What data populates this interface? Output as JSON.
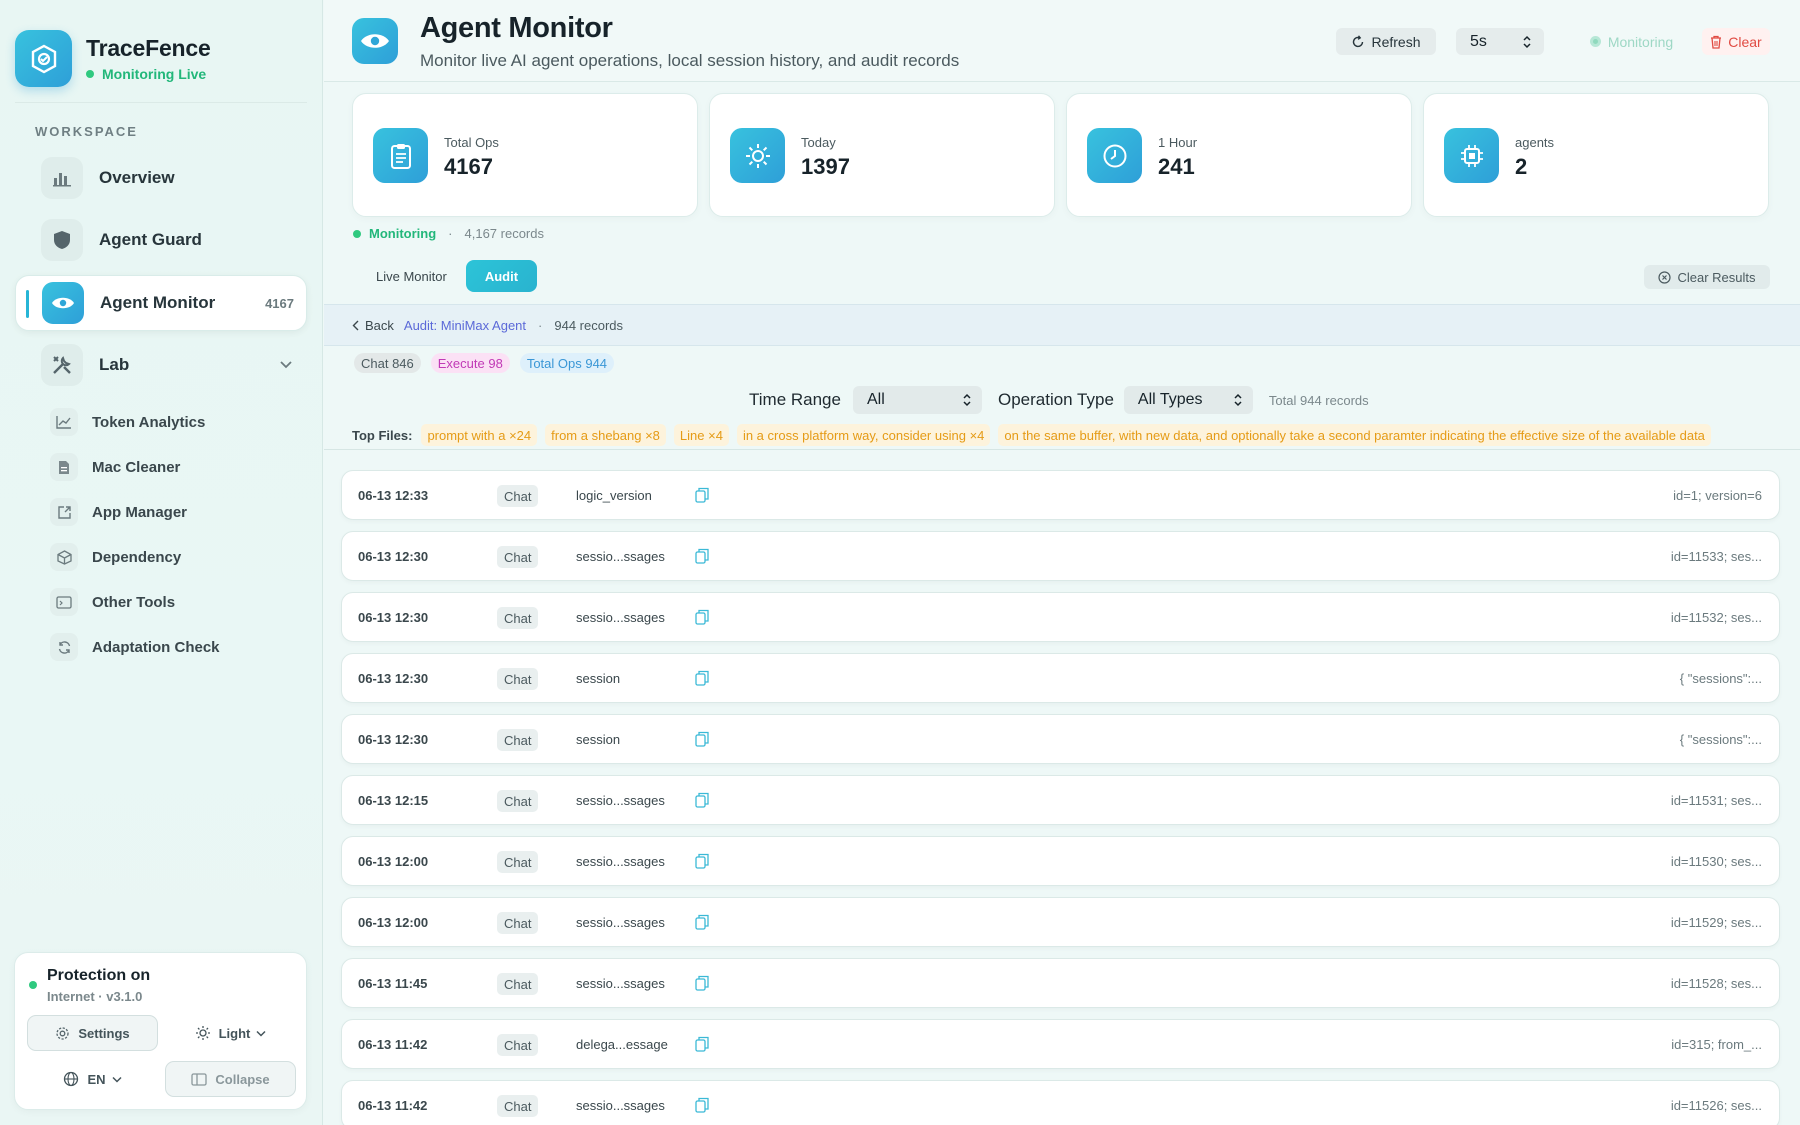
{
  "brand": {
    "name": "TraceFence",
    "status": "Monitoring Live"
  },
  "sidebar": {
    "section_label": "WORKSPACE",
    "items": [
      {
        "label": "Overview",
        "icon": "bar-chart-icon"
      },
      {
        "label": "Agent Guard",
        "icon": "shield-icon"
      },
      {
        "label": "Agent Monitor",
        "icon": "eye-icon",
        "badge": "4167"
      },
      {
        "label": "Lab",
        "icon": "tools-icon"
      }
    ],
    "sub_items": [
      {
        "label": "Token Analytics",
        "icon": "line-chart-icon"
      },
      {
        "label": "Mac Cleaner",
        "icon": "document-icon"
      },
      {
        "label": "App Manager",
        "icon": "external-box-icon"
      },
      {
        "label": "Dependency",
        "icon": "cube-icon"
      },
      {
        "label": "Other Tools",
        "icon": "terminal-window-icon"
      },
      {
        "label": "Adaptation Check",
        "icon": "refresh-icon"
      }
    ],
    "protection": {
      "title": "Protection on",
      "subtitle": "Internet · v3.1.0"
    },
    "settings_label": "Settings",
    "theme_label": "Light",
    "language_label": "EN",
    "collapse_label": "Collapse"
  },
  "header": {
    "title": "Agent Monitor",
    "subtitle": "Monitor live AI agent operations, local session history, and audit records",
    "refresh_label": "Refresh",
    "interval_value": "5s",
    "monitoring_label": "Monitoring",
    "clear_label": "Clear"
  },
  "stats": [
    {
      "label": "Total Ops",
      "value": "4167",
      "icon": "clipboard-icon"
    },
    {
      "label": "Today",
      "value": "1397",
      "icon": "sun-icon"
    },
    {
      "label": "1 Hour",
      "value": "241",
      "icon": "clock-icon"
    },
    {
      "label": "agents",
      "value": "2",
      "icon": "chip-icon"
    }
  ],
  "status_line": {
    "state": "Monitoring",
    "records": "4,167 records"
  },
  "tabs": [
    {
      "label": "Live Monitor",
      "active": false
    },
    {
      "label": "Audit",
      "active": true
    }
  ],
  "clear_results_label": "Clear Results",
  "audit": {
    "back_label": "Back",
    "name": "Audit: MiniMax Agent",
    "records": "944 records"
  },
  "chips": [
    {
      "label": "Chat 846",
      "kind": "chat"
    },
    {
      "label": "Execute 98",
      "kind": "exec"
    },
    {
      "label": "Total Ops 944",
      "kind": "total"
    }
  ],
  "filters": {
    "time_range_label": "Time Range",
    "time_range_value": "All",
    "op_type_label": "Operation Type",
    "op_type_value": "All Types",
    "total": "Total 944 records"
  },
  "top_files": {
    "label": "Top Files:",
    "items": [
      "prompt with a ×24",
      "from a shebang ×8",
      "Line ×4",
      "in a cross platform way, consider using ×4",
      "on the same buffer, with new data, and optionally take a second paramter indicating the effective size of the available data"
    ]
  },
  "rows": [
    {
      "time": "06-13 12:33",
      "type": "Chat",
      "name": "logic_version",
      "detail": "id=1; version=6"
    },
    {
      "time": "06-13 12:30",
      "type": "Chat",
      "name": "sessio...ssages",
      "detail": "id=11533; ses..."
    },
    {
      "time": "06-13 12:30",
      "type": "Chat",
      "name": "sessio...ssages",
      "detail": "id=11532; ses..."
    },
    {
      "time": "06-13 12:30",
      "type": "Chat",
      "name": "session",
      "detail": "{   \"sessions\":..."
    },
    {
      "time": "06-13 12:30",
      "type": "Chat",
      "name": "session",
      "detail": "{   \"sessions\":..."
    },
    {
      "time": "06-13 12:15",
      "type": "Chat",
      "name": "sessio...ssages",
      "detail": "id=11531; ses..."
    },
    {
      "time": "06-13 12:00",
      "type": "Chat",
      "name": "sessio...ssages",
      "detail": "id=11530; ses..."
    },
    {
      "time": "06-13 12:00",
      "type": "Chat",
      "name": "sessio...ssages",
      "detail": "id=11529; ses..."
    },
    {
      "time": "06-13 11:45",
      "type": "Chat",
      "name": "sessio...ssages",
      "detail": "id=11528; ses..."
    },
    {
      "time": "06-13 11:42",
      "type": "Chat",
      "name": "delega...essage",
      "detail": "id=315; from_..."
    },
    {
      "time": "06-13 11:42",
      "type": "Chat",
      "name": "sessio...ssages",
      "detail": "id=11526; ses..."
    }
  ],
  "colors": {
    "accent": "#29b3cf",
    "live": "#22b77a",
    "danger": "#e14b43",
    "audit_link": "#5b69d8",
    "top_file": "#e59b16"
  }
}
